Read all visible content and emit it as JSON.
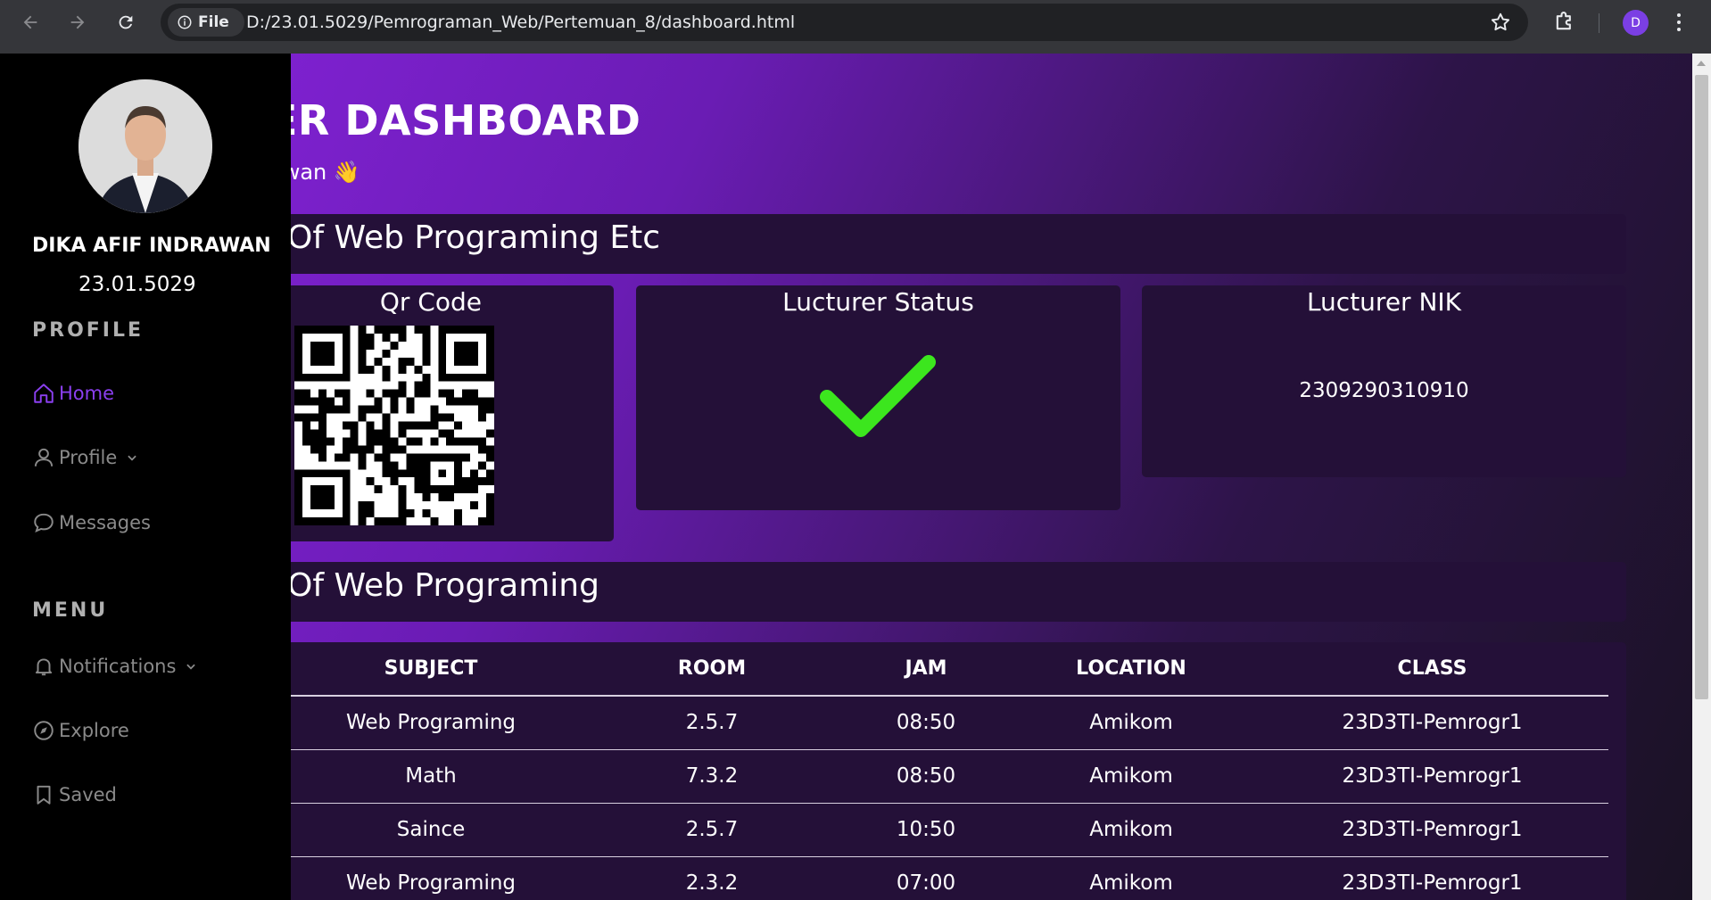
{
  "browser": {
    "chip_label": "File",
    "url": "D:/23.01.5029/Pemrograman_Web/Pertemuan_8/dashboard.html",
    "profile_initial": "D"
  },
  "sidebar": {
    "name": "DIKA AFIF INDRAWAN",
    "id": "23.01.5029",
    "profile_heading": "PROFILE",
    "profile_items": [
      {
        "label": "Home",
        "icon": "home-icon"
      },
      {
        "label": "Profile",
        "icon": "user-icon"
      },
      {
        "label": "Messages",
        "icon": "message-icon"
      }
    ],
    "menu_heading": "MENU",
    "menu_items": [
      {
        "label": "Notifications",
        "icon": "bell-icon"
      },
      {
        "label": "Explore",
        "icon": "compass-icon"
      },
      {
        "label": "Saved",
        "icon": "bookmark-icon"
      }
    ]
  },
  "hero": {
    "title": "ER DASHBOARD",
    "subtitle": "awan 👋"
  },
  "section1": {
    "title": "Of Web Programing Etc"
  },
  "cards": {
    "qr_title": "Qr Code",
    "status_title": "Lucturer Status",
    "nik_title": "Lucturer NIK",
    "nik_value": "2309290310910"
  },
  "section2": {
    "title": "Of Web Programing"
  },
  "schedule": {
    "headers": [
      "SUBJECT",
      "ROOM",
      "JAM",
      "LOCATION",
      "CLASS"
    ],
    "rows": [
      [
        "Web Programing",
        "2.5.7",
        "08:50",
        "Amikom",
        "23D3TI-Pemrogr1"
      ],
      [
        "Math",
        "7.3.2",
        "08:50",
        "Amikom",
        "23D3TI-Pemrogr1"
      ],
      [
        "Saince",
        "2.5.7",
        "10:50",
        "Amikom",
        "23D3TI-Pemrogr1"
      ],
      [
        "Web Programing",
        "2.3.2",
        "07:00",
        "Amikom",
        "23D3TI-Pemrogr1"
      ]
    ]
  },
  "colors": {
    "accent": "#8b3ff0",
    "check": "#3ce61e",
    "card_bg": "#241038"
  }
}
